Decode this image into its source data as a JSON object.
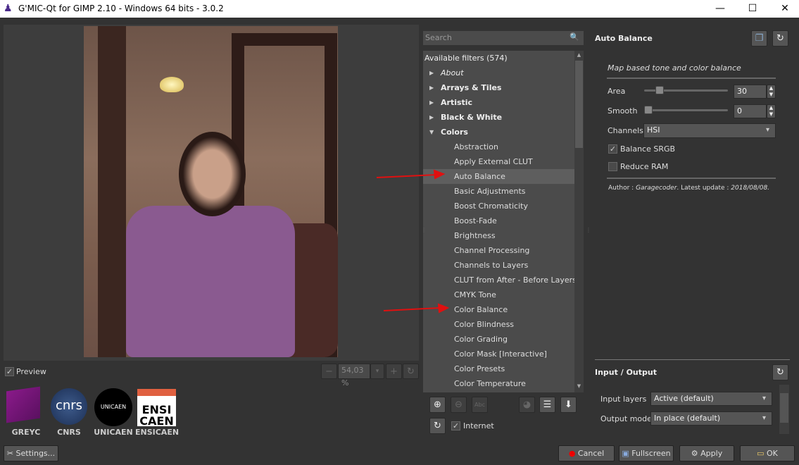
{
  "window": {
    "title": "G'MIC-Qt for GIMP 2.10 - Windows 64 bits - 3.0.2",
    "minimize": "—",
    "maximize": "☐",
    "close": "✕"
  },
  "preview": {
    "checkbox_label": "Preview",
    "checked": true,
    "zoom_value": "54,03 %"
  },
  "logos": [
    "GREYC",
    "CNRS",
    "UNICAEN",
    "ENSICAEN"
  ],
  "logo_text": {
    "cnrs": "cnrs",
    "unicaen": "UNICAEN",
    "ensicaen_top": "ENSI",
    "ensicaen_bottom": "CAEN"
  },
  "settings_label": "Settings...",
  "search": {
    "placeholder": "Search"
  },
  "filters": {
    "header": "Available filters (574)",
    "items": [
      {
        "label": "About",
        "type": "cat",
        "italic": true
      },
      {
        "label": "Arrays & Tiles",
        "type": "cat"
      },
      {
        "label": "Artistic",
        "type": "cat"
      },
      {
        "label": "Black & White",
        "type": "cat"
      },
      {
        "label": "Colors",
        "type": "cat",
        "open": true
      },
      {
        "label": "Abstraction",
        "type": "sub"
      },
      {
        "label": "Apply External CLUT",
        "type": "sub"
      },
      {
        "label": "Auto Balance",
        "type": "sub",
        "selected": true
      },
      {
        "label": "Basic Adjustments",
        "type": "sub"
      },
      {
        "label": "Boost Chromaticity",
        "type": "sub"
      },
      {
        "label": "Boost-Fade",
        "type": "sub"
      },
      {
        "label": "Brightness",
        "type": "sub"
      },
      {
        "label": "Channel Processing",
        "type": "sub"
      },
      {
        "label": "Channels to Layers",
        "type": "sub"
      },
      {
        "label": "CLUT from After - Before Layers",
        "type": "sub"
      },
      {
        "label": "CMYK Tone",
        "type": "sub"
      },
      {
        "label": "Color Balance",
        "type": "sub"
      },
      {
        "label": "Color Blindness",
        "type": "sub"
      },
      {
        "label": "Color Grading",
        "type": "sub"
      },
      {
        "label": "Color Mask [Interactive]",
        "type": "sub"
      },
      {
        "label": "Color Presets",
        "type": "sub"
      },
      {
        "label": "Color Temperature",
        "type": "sub"
      }
    ],
    "internet_label": "Internet",
    "internet_checked": true
  },
  "filter_panel": {
    "title": "Auto Balance",
    "description": "Map based tone and color balance",
    "area": {
      "label": "Area",
      "value": "30",
      "fraction": 0.15
    },
    "smooth": {
      "label": "Smooth",
      "value": "0",
      "fraction": 0
    },
    "channels": {
      "label": "Channels",
      "value": "HSI"
    },
    "balance_srgb": {
      "label": "Balance SRGB",
      "checked": true
    },
    "reduce_ram": {
      "label": "Reduce RAM",
      "checked": false
    },
    "author_prefix": "Author : ",
    "author": "Garagecoder",
    "update_prefix": ". Latest update : ",
    "update": "2018/08/08."
  },
  "io": {
    "title": "Input / Output",
    "input_layers": {
      "label": "Input layers",
      "value": "Active (default)"
    },
    "output_mode": {
      "label": "Output mode",
      "value": "In place (default)"
    }
  },
  "buttons": {
    "cancel": "Cancel",
    "fullscreen": "Fullscreen",
    "apply": "Apply",
    "ok": "OK"
  },
  "colors": {
    "arrow": "#e01010",
    "bg": "#333333"
  }
}
